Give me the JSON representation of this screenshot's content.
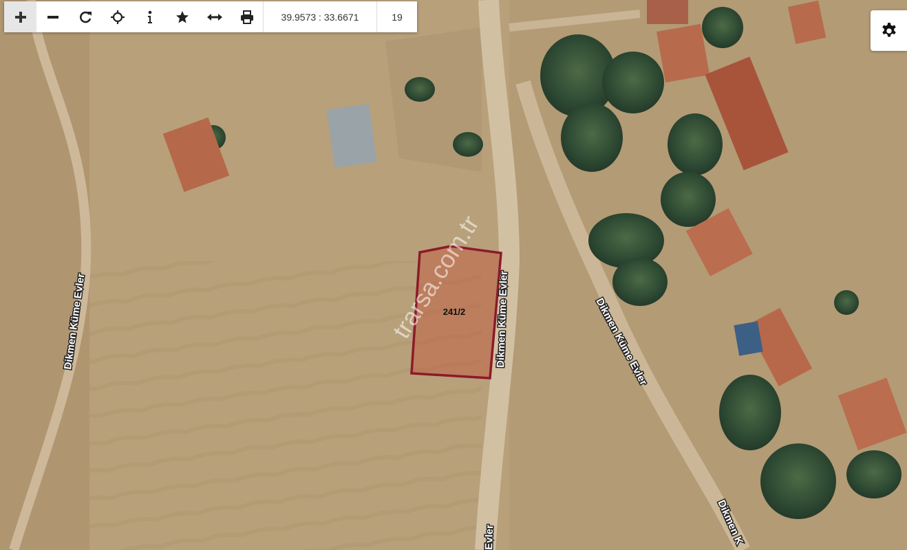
{
  "toolbar": {
    "buttons": [
      {
        "name": "zoom-in-button",
        "icon": "plus-icon"
      },
      {
        "name": "zoom-out-button",
        "icon": "minus-icon"
      },
      {
        "name": "refresh-button",
        "icon": "refresh-icon"
      },
      {
        "name": "locate-button",
        "icon": "crosshair-icon"
      },
      {
        "name": "info-button",
        "icon": "info-icon"
      },
      {
        "name": "favorite-button",
        "icon": "star-icon"
      },
      {
        "name": "measure-button",
        "icon": "arrows-horizontal-icon"
      },
      {
        "name": "print-button",
        "icon": "printer-icon"
      }
    ],
    "coordinates": "39.9573 : 33.6671",
    "zoom_level": "19"
  },
  "settings": {
    "icon": "gear-icon"
  },
  "map": {
    "parcel_label": "241/2",
    "parcel_color": "#8b1a2b",
    "watermark": "trarsa.com.tr",
    "road_labels": {
      "west": "Dikmen Küme Evler",
      "center": "Dikmen Küme Evler",
      "east": "Dikmen Küme Evler",
      "bottom_center": "Evler",
      "bottom_right": "Dikmen K"
    }
  }
}
